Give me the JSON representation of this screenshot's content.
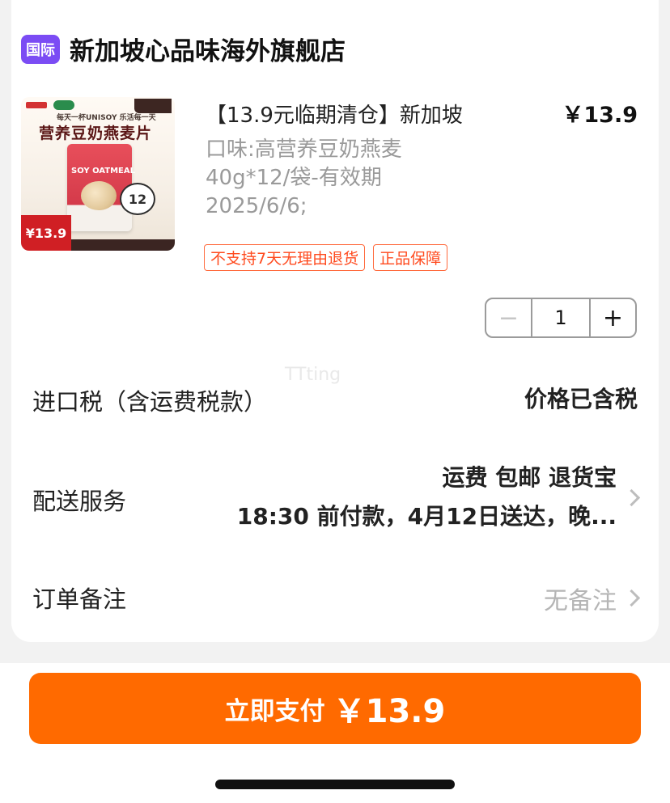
{
  "store": {
    "badge": "国际",
    "name": "新加坡心品味海外旗舰店"
  },
  "product": {
    "title": "【13.9元临期清仓】新加坡",
    "price": "￥13.9",
    "spec_lines": [
      "口味:高营养豆奶燕麦",
      "40g*12/袋-有效期",
      "2025/6/6;"
    ],
    "tags": [
      "不支持7天无理由退货",
      "正品保障"
    ],
    "image_texts": {
      "line1": "每天一杯UNISOY 乐活每一天",
      "line2": "营养豆奶燕麦片",
      "pack_title": "SOY OATMEAL",
      "count": "12",
      "price_tag": "¥13.9"
    }
  },
  "stepper": {
    "minus": "−",
    "quantity": "1",
    "plus": "+"
  },
  "watermark": "TTting",
  "rows": {
    "tax_label": "进口税（含运费税款）",
    "tax_value": "价格已含税",
    "delivery_label": "配送服务",
    "delivery_line1": "运费 包邮 退货宝",
    "delivery_line2": "18:30 前付款，4月12日送达，晚...",
    "remark_label": "订单备注",
    "remark_value": "无备注"
  },
  "pay": {
    "label": "立即支付",
    "amount": "￥13.9"
  },
  "colors": {
    "accent": "#ff6a00",
    "badge": "#7b4cf4",
    "tag": "#ff4a1e"
  }
}
